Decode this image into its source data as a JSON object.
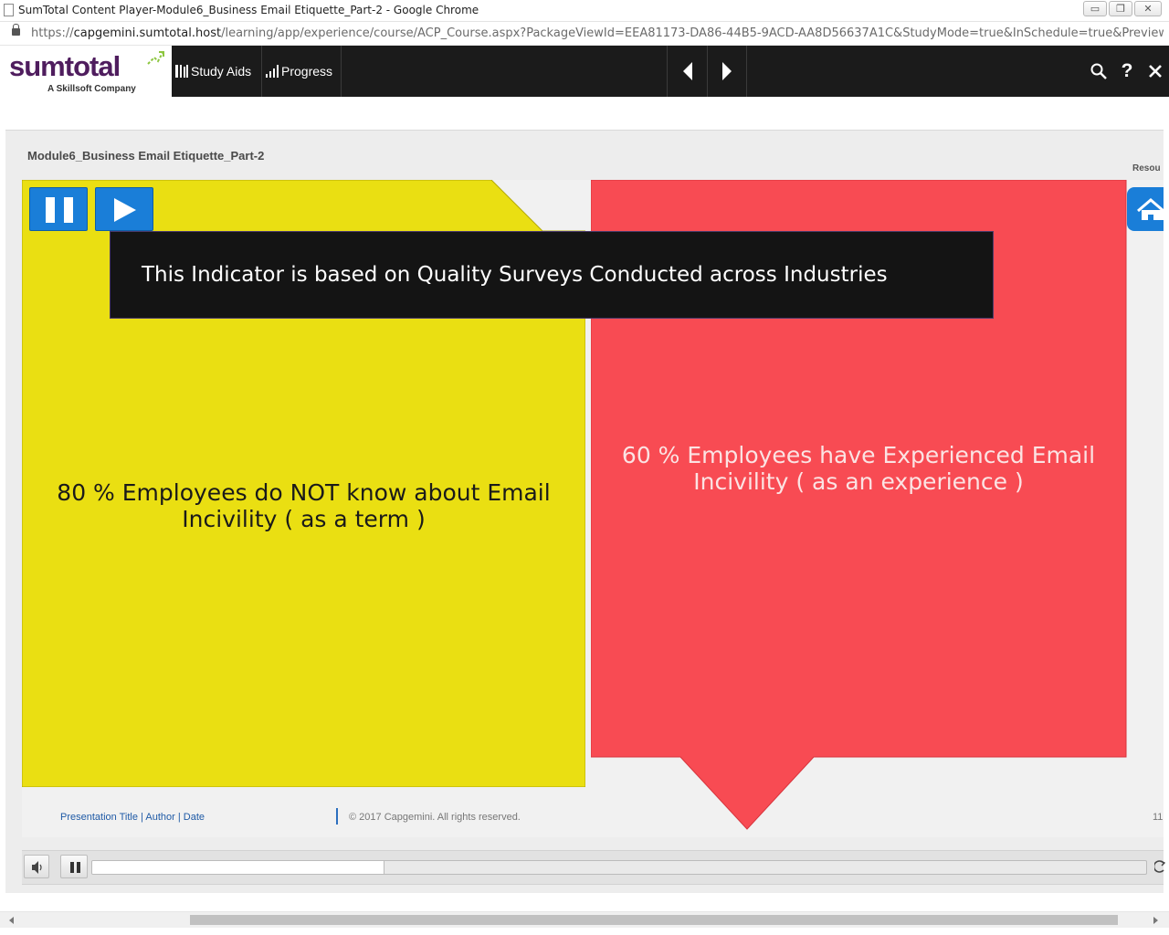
{
  "window": {
    "title": "SumTotal Content Player-Module6_Business Email Etiquette_Part-2 - Google Chrome",
    "url_scheme": "https://",
    "url_host": "capgemini.sumtotal.host",
    "url_path": "/learning/app/experience/course/ACP_Course.aspx?PackageViewId=EEA81173-DA86-44B5-9ACD-AA8D56637A1C&StudyMode=true&InSchedule=true&Preview=0&..."
  },
  "nav": {
    "logo_text": "sumtotal",
    "logo_subtitle": "A Skillsoft Company",
    "study_aids_label": "Study Aids",
    "progress_label": "Progress"
  },
  "player": {
    "module_title": "Module6_Business Email Etiquette_Part-2",
    "resources_label": "Resou",
    "caption": "This Indicator is based on Quality Surveys Conducted across Industries",
    "yellow_statement": "80 % Employees do NOT know about Email Incivility ( as a term )",
    "red_statement": "60 % Employees have Experienced Email Incivility ( as an experience )",
    "footer": {
      "presentation_title": "Presentation Title",
      "author": "Author",
      "date": "Date",
      "separator": " | ",
      "copyright": "© 2017 Capgemini. All rights reserved.",
      "page_number": "11"
    },
    "playback_progress_fraction": 0.277
  },
  "colors": {
    "yellow_panel": "#eadf12",
    "red_panel": "#f84b53",
    "accent_blue": "#1a7ed8",
    "logo_purple": "#4f1d5e",
    "nav_bg": "#1b1b1b"
  },
  "icons": {
    "study_aids": "study-aids-icon",
    "progress": "progress-icon",
    "prev": "chevron-left-icon",
    "next": "chevron-right-icon",
    "search": "search-icon",
    "help": "help-icon",
    "close": "close-icon",
    "pause": "pause-icon",
    "play": "play-icon",
    "home": "home-icon",
    "volume": "speaker-icon",
    "reload": "reload-icon"
  }
}
